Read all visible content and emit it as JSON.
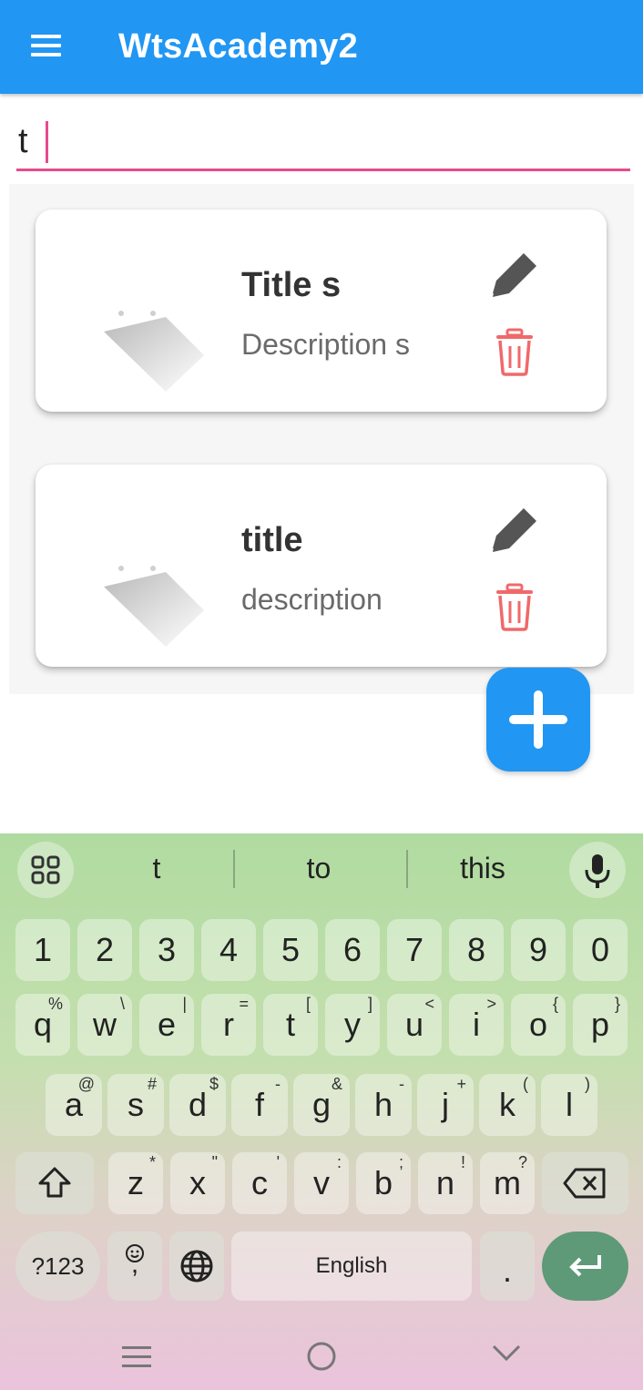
{
  "appbar": {
    "title": "WtsAcademy2",
    "menu_icon": "hamburger-menu-icon"
  },
  "search": {
    "value": "t"
  },
  "notes": [
    {
      "title": "Title s",
      "description": "Description s"
    },
    {
      "title": "title",
      "description": "description"
    }
  ],
  "keyboard": {
    "suggestions": [
      "t",
      "to",
      "this"
    ],
    "rows": {
      "numbers": [
        "1",
        "2",
        "3",
        "4",
        "5",
        "6",
        "7",
        "8",
        "9",
        "0"
      ],
      "row1": [
        {
          "k": "q",
          "s": "%"
        },
        {
          "k": "w",
          "s": "\\"
        },
        {
          "k": "e",
          "s": "|"
        },
        {
          "k": "r",
          "s": "="
        },
        {
          "k": "t",
          "s": "["
        },
        {
          "k": "y",
          "s": "]"
        },
        {
          "k": "u",
          "s": "<"
        },
        {
          "k": "i",
          "s": ">"
        },
        {
          "k": "o",
          "s": "{"
        },
        {
          "k": "p",
          "s": "}"
        }
      ],
      "row2": [
        {
          "k": "a",
          "s": "@"
        },
        {
          "k": "s",
          "s": "#"
        },
        {
          "k": "d",
          "s": "$"
        },
        {
          "k": "f",
          "s": "-"
        },
        {
          "k": "g",
          "s": "&"
        },
        {
          "k": "h",
          "s": "-"
        },
        {
          "k": "j",
          "s": "+"
        },
        {
          "k": "k",
          "s": "("
        },
        {
          "k": "l",
          "s": ")"
        }
      ],
      "row3": [
        {
          "k": "z",
          "s": "*"
        },
        {
          "k": "x",
          "s": "\""
        },
        {
          "k": "c",
          "s": "'"
        },
        {
          "k": "v",
          "s": ":"
        },
        {
          "k": "b",
          "s": ";"
        },
        {
          "k": "n",
          "s": "!"
        },
        {
          "k": "m",
          "s": "?"
        }
      ]
    },
    "symbols_key": "?123",
    "emoji_key_secondary": ",",
    "space_label": "English",
    "period_key": "."
  },
  "colors": {
    "primary": "#2196f3",
    "accent": "#e64b8b",
    "delete": "#f0696a",
    "edit": "#555555",
    "enter": "#5e9a78"
  }
}
